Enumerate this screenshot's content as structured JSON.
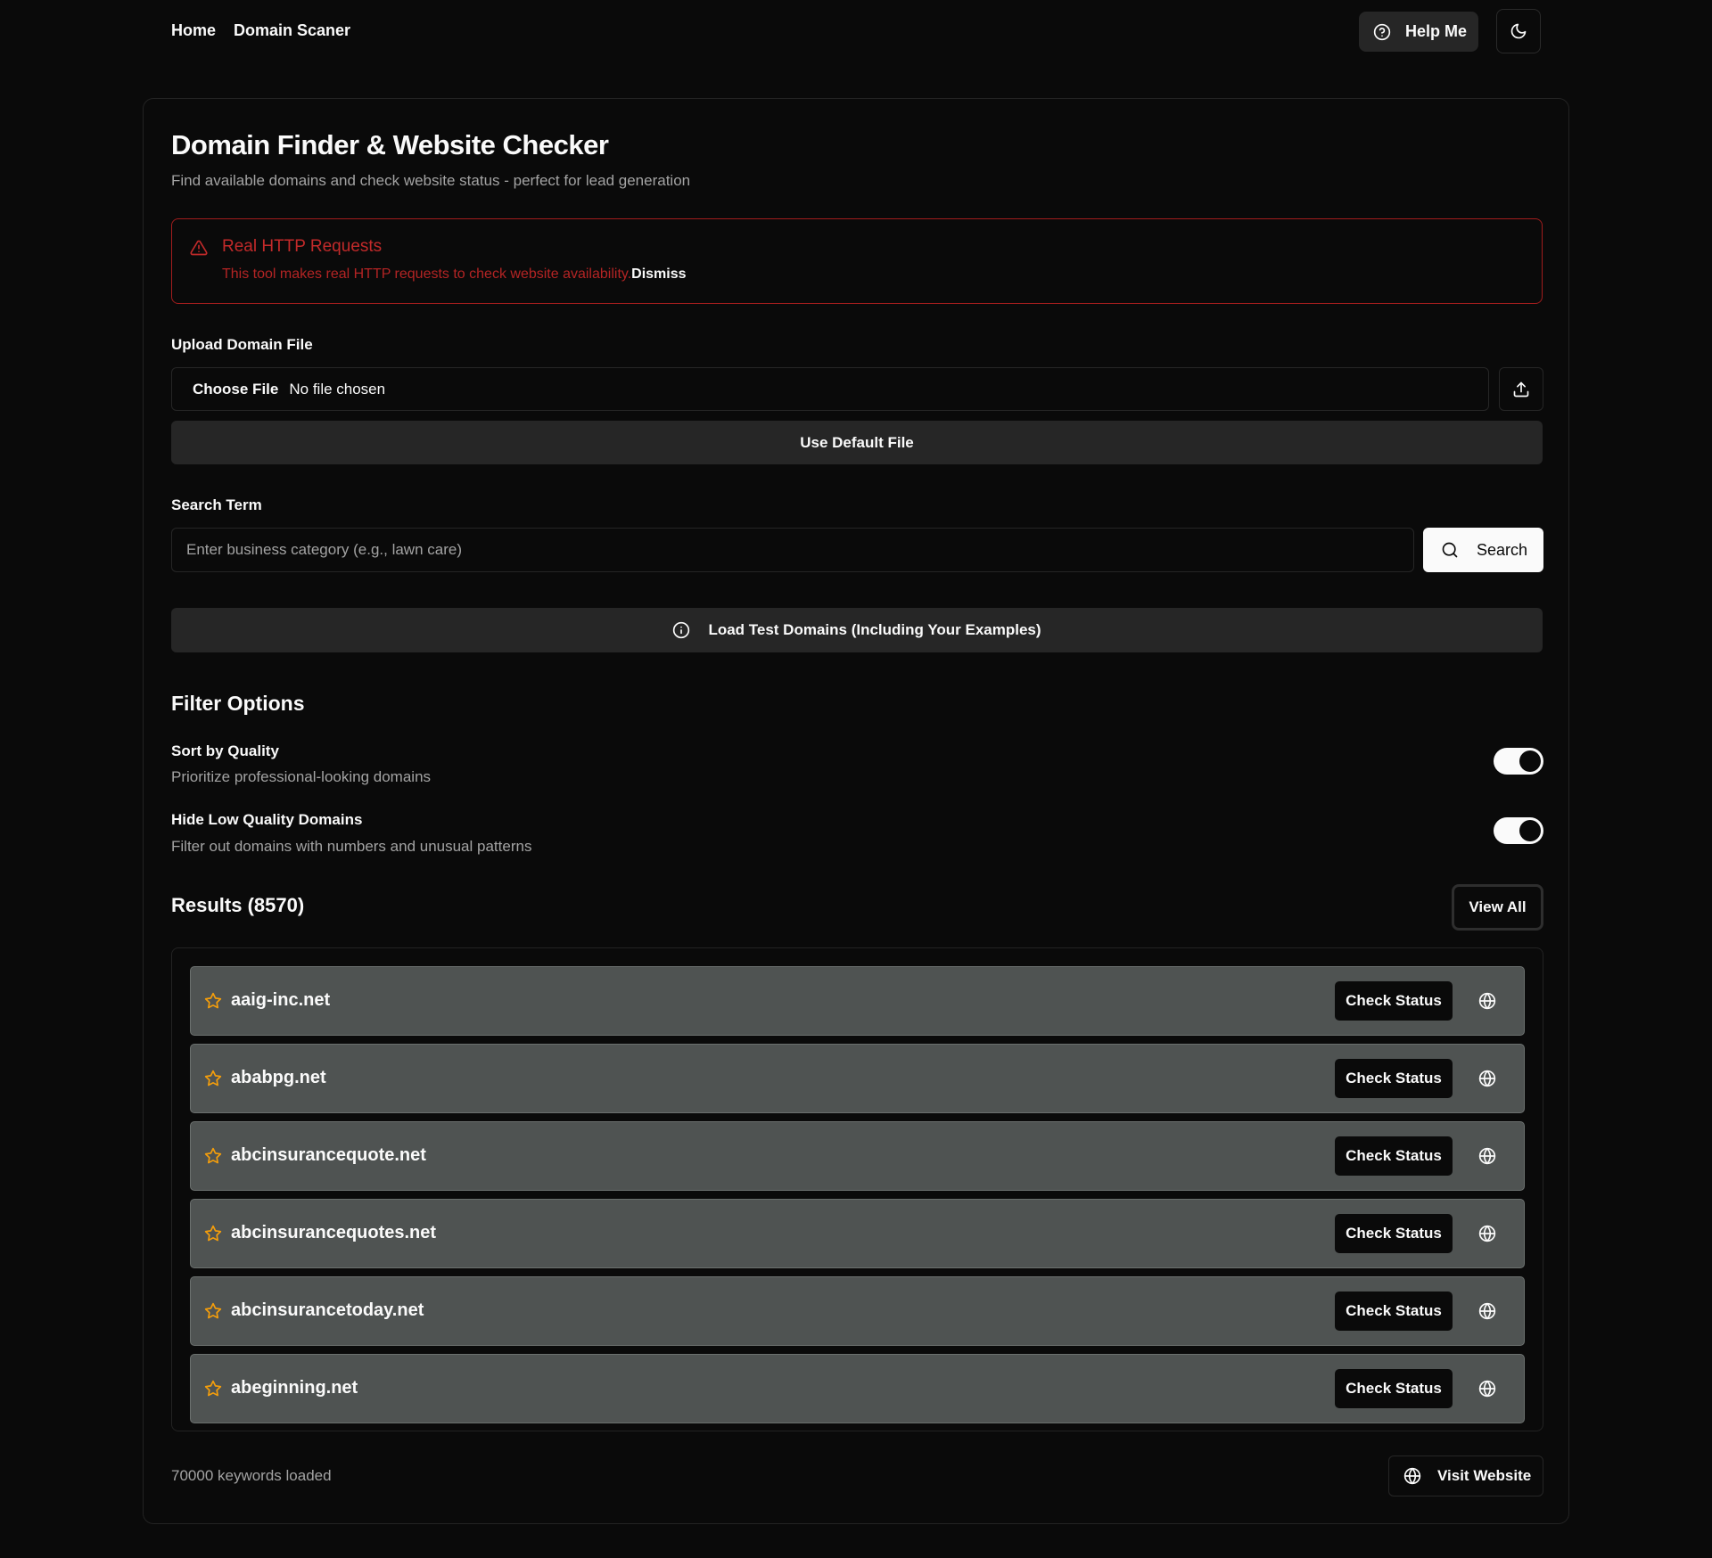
{
  "nav": {
    "links": [
      "Home",
      "Domain Scaner"
    ],
    "help_label": "Help Me",
    "theme_icon": "moon-icon"
  },
  "header": {
    "title": "Domain Finder & Website Checker",
    "subtitle": "Find available domains and check website status - perfect for lead generation"
  },
  "alert": {
    "icon": "warning-triangle-icon",
    "title": "Real HTTP Requests",
    "description": "This tool makes real HTTP requests to check website availability.",
    "dismiss_label": "Dismiss",
    "color": "#c22a2a"
  },
  "upload": {
    "label": "Upload Domain File",
    "choose_label": "Choose File",
    "file_status": "No file chosen",
    "default_button": "Use Default File"
  },
  "search": {
    "label": "Search Term",
    "placeholder": "Enter business category (e.g., lawn care)",
    "value": "",
    "button_label": "Search"
  },
  "test_domains": {
    "button_label": "Load Test Domains (Including Your Examples)"
  },
  "filters": {
    "title": "Filter Options",
    "options": [
      {
        "title": "Sort by Quality",
        "description": "Prioritize professional-looking domains",
        "enabled": true
      },
      {
        "title": "Hide Low Quality Domains",
        "description": "Filter out domains with numbers and unusual patterns",
        "enabled": true
      }
    ]
  },
  "results": {
    "title": "Results (8570)",
    "view_all_label": "View All",
    "check_label": "Check Status",
    "star_color": "#f59e0b",
    "items": [
      "aaig-inc.net",
      "ababpg.net",
      "abcinsurancequote.net",
      "abcinsurancequotes.net",
      "abcinsurancetoday.net",
      "abeginning.net"
    ]
  },
  "footer": {
    "status": "70000 keywords loaded",
    "visit_label": "Visit Website"
  }
}
